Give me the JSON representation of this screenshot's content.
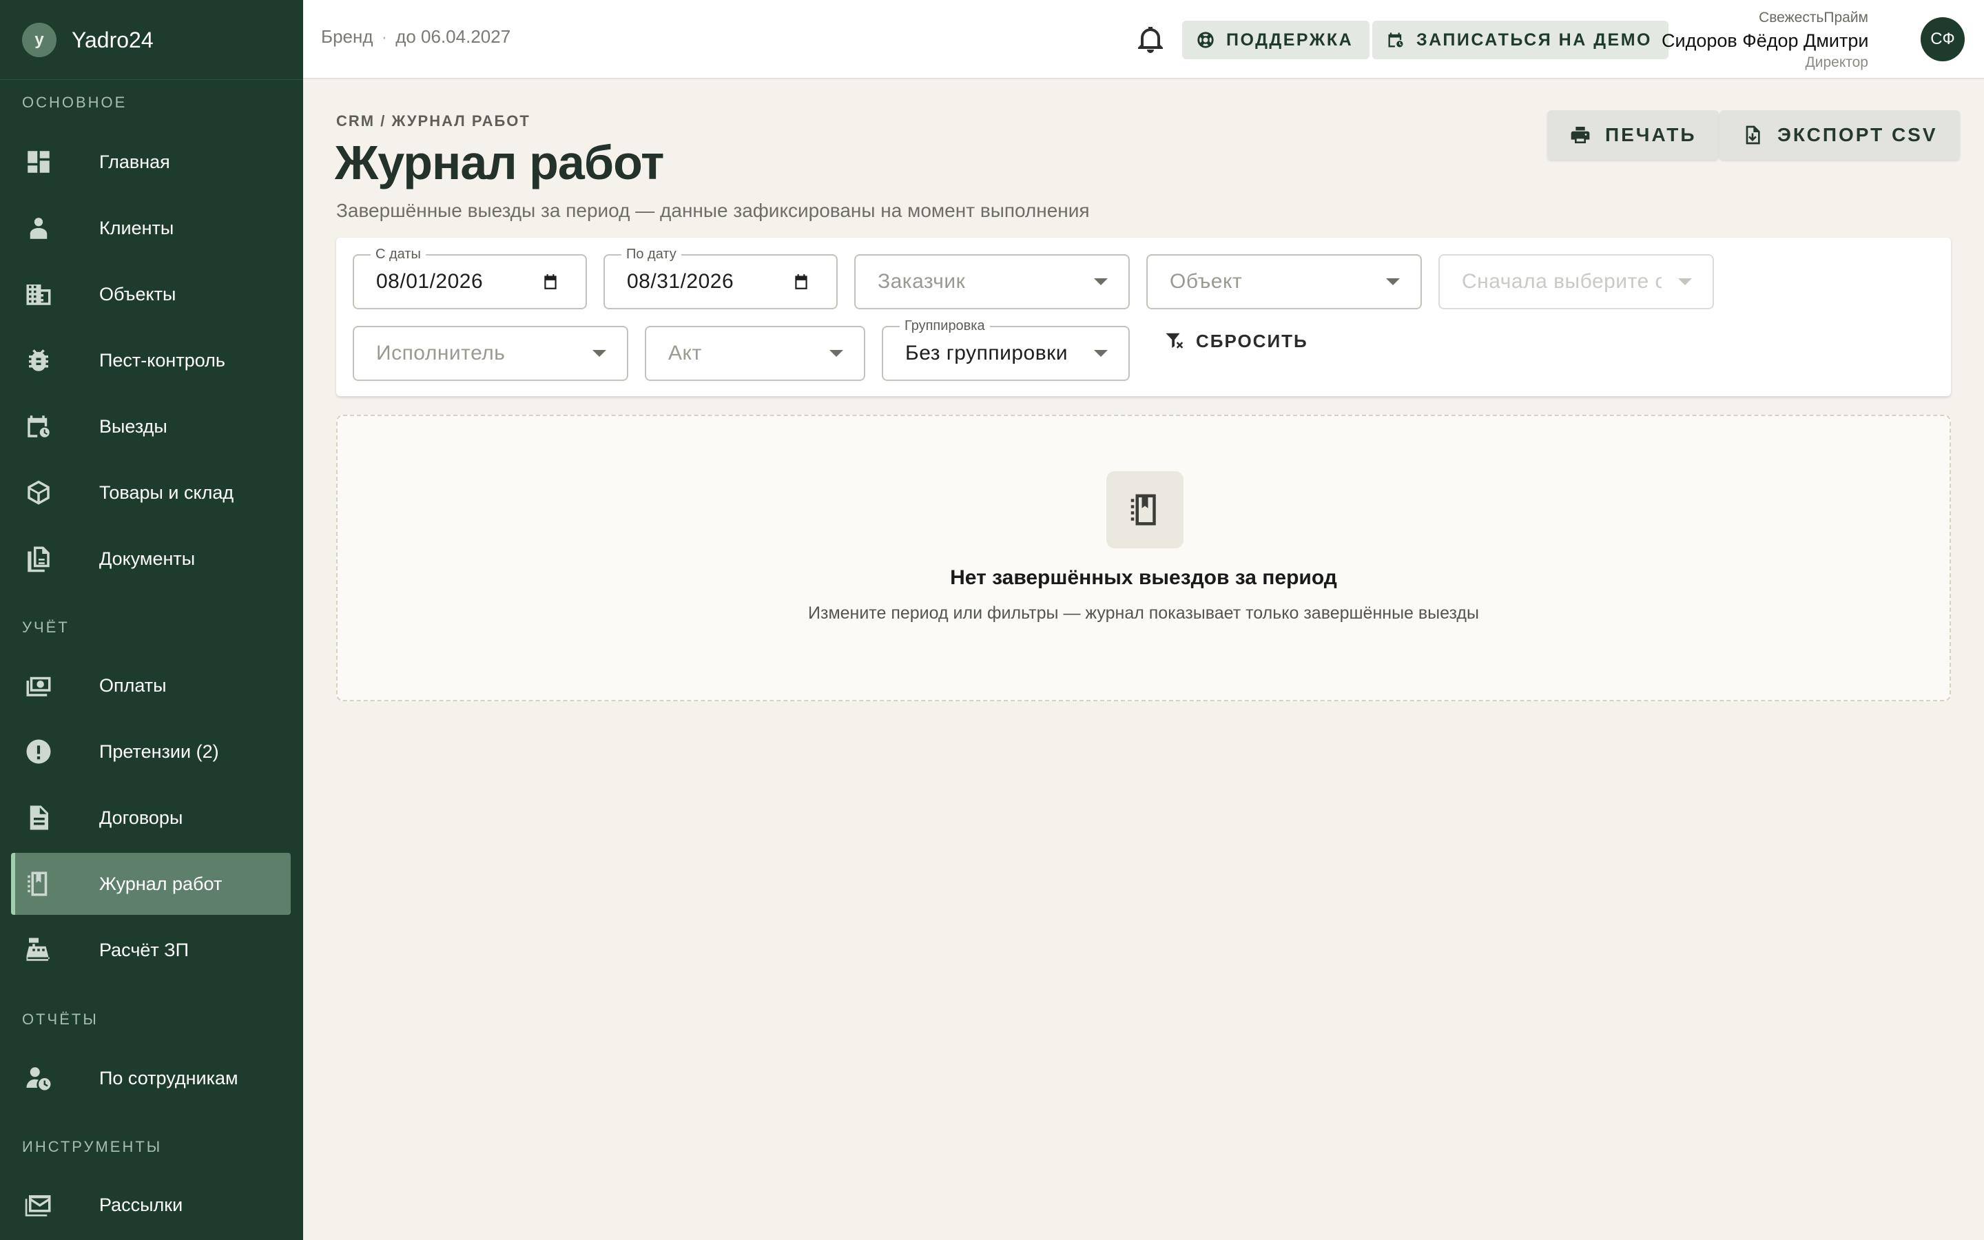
{
  "app": {
    "name": "Yadro24",
    "logo_letter": "y"
  },
  "sidebar": {
    "sections": [
      {
        "title": "Основное"
      },
      {
        "title": "Учёт"
      },
      {
        "title": "Отчёты"
      },
      {
        "title": "Инструменты"
      }
    ],
    "items": [
      {
        "label": "Главная",
        "icon": "dashboard-icon"
      },
      {
        "label": "Клиенты",
        "icon": "clients-icon"
      },
      {
        "label": "Объекты",
        "icon": "building-icon"
      },
      {
        "label": "Пест-контроль",
        "icon": "bug-icon"
      },
      {
        "label": "Выезды",
        "icon": "calendar-clock-icon"
      },
      {
        "label": "Товары и склад",
        "icon": "box-icon"
      },
      {
        "label": "Документы",
        "icon": "documents-icon"
      },
      {
        "label": "Оплаты",
        "icon": "money-icon"
      },
      {
        "label": "Претензии (2)",
        "icon": "alert-icon"
      },
      {
        "label": "Договоры",
        "icon": "contract-icon"
      },
      {
        "label": "Журнал работ",
        "icon": "journal-icon",
        "active": true
      },
      {
        "label": "Расчёт ЗП",
        "icon": "cash-register-icon"
      },
      {
        "label": "По сотрудникам",
        "icon": "employee-clock-icon"
      },
      {
        "label": "Рассылки",
        "icon": "mail-icon"
      }
    ]
  },
  "topbar": {
    "brand_label": "Бренд",
    "separator": "·",
    "valid_until": "до 06.04.2027",
    "support_label": "ПОДДЕРЖКА",
    "demo_label": "ЗАПИСАТЬСЯ НА ДЕМО",
    "user": {
      "org": "СвежестьПрайм",
      "name": "Сидоров Фёдор Дмитриев...",
      "role": "Директор",
      "initials": "СФ"
    }
  },
  "page": {
    "breadcrumb": "CRM / ЖУРНАЛ РАБОТ",
    "title": "Журнал работ",
    "subtitle": "Завершённые выезды за период — данные зафиксированы на момент выполнения",
    "print_label": "ПЕЧАТЬ",
    "export_label": "ЭКСПОРТ CSV"
  },
  "filters": {
    "date_from": {
      "label": "С даты",
      "value": "08/01/2026"
    },
    "date_to": {
      "label": "По дату",
      "value": "08/31/2026"
    },
    "customer": {
      "placeholder": "Заказчик"
    },
    "object": {
      "placeholder": "Объект"
    },
    "dependent": {
      "placeholder": "Сначала выберите о"
    },
    "executor": {
      "placeholder": "Исполнитель"
    },
    "act": {
      "placeholder": "Акт"
    },
    "grouping": {
      "label": "Группировка",
      "value": "Без группировки"
    },
    "reset_label": "СБРОСИТЬ"
  },
  "empty_state": {
    "icon": "journal-icon",
    "title": "Нет завершённых выездов за период",
    "text": "Измените период или фильтры — журнал показывает только завершённые выезды"
  },
  "colors": {
    "sidebar_bg": "#1d3c2b",
    "active_item_bg": "#5e806b",
    "page_bg": "#f5f2ec",
    "accent": "#1e3a2a"
  }
}
